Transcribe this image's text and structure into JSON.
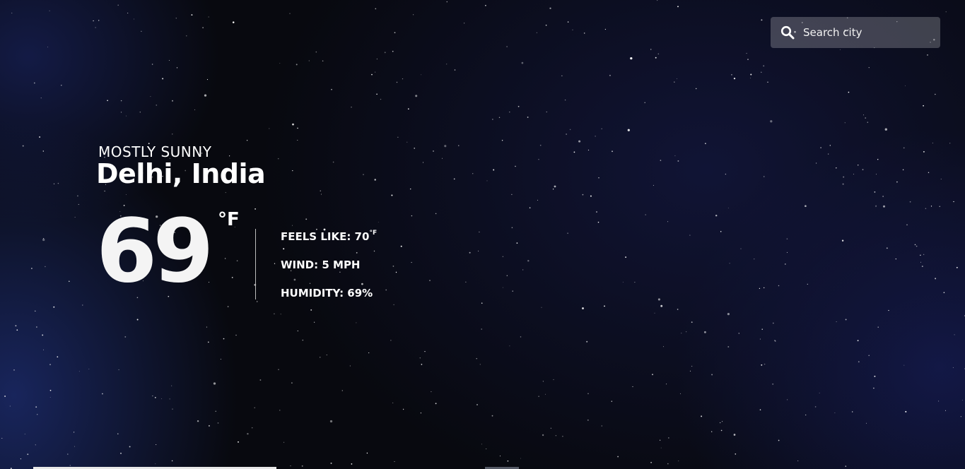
{
  "search": {
    "placeholder": "Search city",
    "icon": "search-icon"
  },
  "weather": {
    "condition": "MOSTLY SUNNY",
    "location": "Delhi, India",
    "temperature": "69",
    "unit": "°F",
    "feels_like_label": "FEELS LIKE: 70",
    "feels_like_unit": "°F",
    "wind": "WIND: 5 MPH",
    "humidity": "HUMIDITY: 69%"
  },
  "colors": {
    "background": "#08090f",
    "text": "#ffffff",
    "search_bg": "rgba(255,255,255,0.22)"
  }
}
